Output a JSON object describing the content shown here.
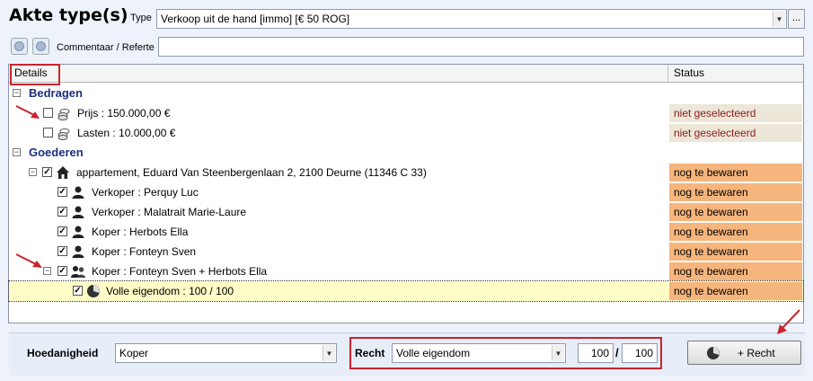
{
  "header": {
    "title": "Akte type(s)",
    "type_label": "Type",
    "type_value": "Verkoop uit de hand [immo] [€ 50 ROG]",
    "ellipsis_label": "...",
    "comment_label": "Commentaar / Referte",
    "comment_value": ""
  },
  "grid": {
    "col_details": "Details",
    "col_status": "Status",
    "categories": {
      "bedragen": "Bedragen",
      "goederen": "Goederen"
    },
    "rows": {
      "prijs": {
        "text": "Prijs : 150.000,00 €",
        "status": "niet geselecteerd"
      },
      "lasten": {
        "text": "Lasten : 10.000,00 €",
        "status": "niet geselecteerd"
      },
      "appartement": {
        "text": "appartement, Eduard Van Steenbergenlaan 2, 2100 Deurne (11346 C 33)",
        "status": "nog te bewaren"
      },
      "verkoper1": {
        "text": "Verkoper : Perquy Luc",
        "status": "nog te bewaren"
      },
      "verkoper2": {
        "text": "Verkoper : Malatrait Marie-Laure",
        "status": "nog te bewaren"
      },
      "koper1": {
        "text": "Koper : Herbots Ella",
        "status": "nog te bewaren"
      },
      "koper2": {
        "text": "Koper : Fonteyn Sven",
        "status": "nog te bewaren"
      },
      "koper3": {
        "text": "Koper : Fonteyn Sven + Herbots Ella",
        "status": "nog te bewaren"
      },
      "volle": {
        "text": "Volle eigendom : 100 / 100",
        "status": "nog te bewaren"
      }
    }
  },
  "bottom": {
    "hoedanigheid_label": "Hoedanigheid",
    "hoedanigheid_value": "Koper",
    "recht_label": "Recht",
    "recht_value": "Volle eigendom",
    "num1": "100",
    "slash": "/",
    "num2": "100",
    "add_recht_label": "+  Recht"
  },
  "colors": {
    "status_grey": "#ece7d8",
    "status_orange": "#f6b57c",
    "highlight_red": "#c8242c",
    "category_blue": "#1d2f7d"
  }
}
